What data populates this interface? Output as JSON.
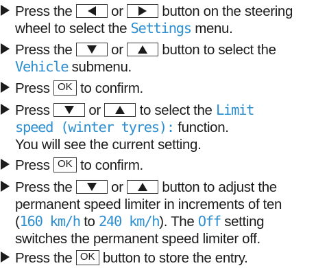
{
  "keys": {
    "ok": "OK"
  },
  "steps": [
    {
      "s1": "Press the",
      "s2": "or",
      "s3": "button on the steering",
      "l2a": "wheel to select the",
      "menu": "Settings",
      "l2b": "menu."
    },
    {
      "s1": "Press the",
      "s2": "or",
      "s3": "button to select the",
      "submenu": "Vehicle",
      "l2b": "submenu."
    },
    {
      "s1": "Press",
      "s2": "to confirm."
    },
    {
      "s1": "Press",
      "s2": "or",
      "s3": "to select the",
      "fn1": "Limit",
      "fn2": "speed (winter tyres):",
      "l2b": "function.",
      "l3": "You will see the current setting."
    },
    {
      "s1": "Press",
      "s2": "to confirm."
    },
    {
      "s1": "Press the",
      "s2": "or",
      "s3": "button to adjust the",
      "l2": "permanent speed limiter in increments of ten",
      "open": "(",
      "v1": "160 km/h",
      "to": "to",
      "v2": "240 km/h",
      "close": "). The",
      "off": "Off",
      "setting": "setting",
      "l4": "switches the permanent speed limiter off."
    },
    {
      "s1": "Press the",
      "s2": "button to store the entry."
    }
  ]
}
